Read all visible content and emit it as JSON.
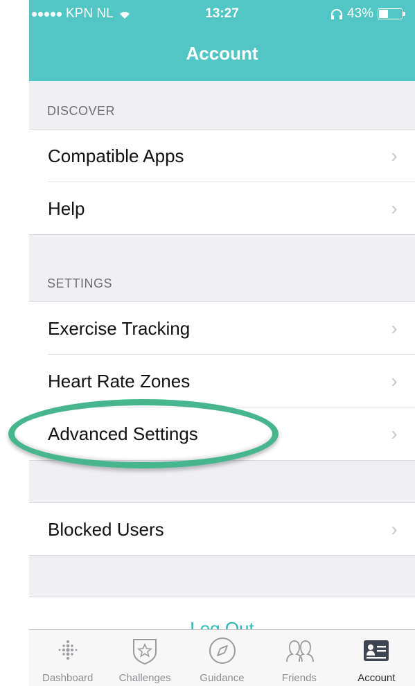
{
  "status_bar": {
    "carrier": "KPN NL",
    "time": "13:27",
    "battery": "43%",
    "battery_level": 0.43
  },
  "nav": {
    "title": "Account"
  },
  "sections": {
    "discover": {
      "header": "DISCOVER",
      "items": [
        {
          "label": "Compatible Apps"
        },
        {
          "label": "Help"
        }
      ]
    },
    "settings": {
      "header": "SETTINGS",
      "items": [
        {
          "label": "Exercise Tracking"
        },
        {
          "label": "Heart Rate Zones"
        },
        {
          "label": "Advanced Settings"
        }
      ]
    },
    "other": {
      "items": [
        {
          "label": "Blocked Users"
        }
      ]
    }
  },
  "chevron": "›",
  "logout": {
    "label": "Log Out"
  },
  "tabbar": {
    "tabs": [
      {
        "label": "Dashboard",
        "icon": "dashboard-dots-icon"
      },
      {
        "label": "Challenges",
        "icon": "challenges-star-badge-icon"
      },
      {
        "label": "Guidance",
        "icon": "guidance-compass-icon"
      },
      {
        "label": "Friends",
        "icon": "friends-icon"
      },
      {
        "label": "Account",
        "icon": "account-card-icon",
        "active": true
      }
    ]
  },
  "colors": {
    "header": "#52c6c4",
    "accent": "#2cb8b6",
    "highlight_ring": "#47b68e"
  }
}
